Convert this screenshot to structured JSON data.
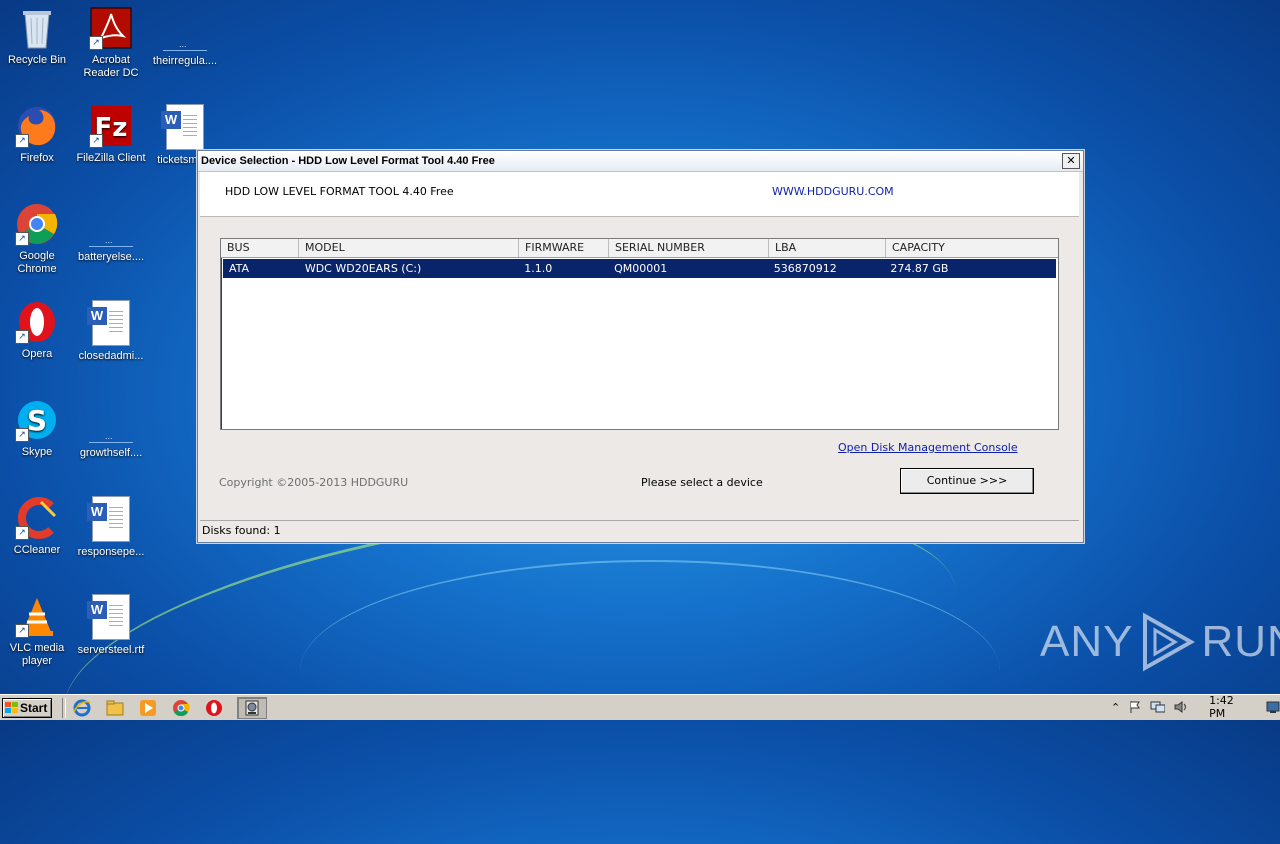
{
  "desktop": {
    "icons": [
      {
        "label": "Recycle Bin"
      },
      {
        "label": "Acrobat Reader DC"
      },
      {
        "label": "theirregula...."
      },
      {
        "label": "Firefox"
      },
      {
        "label": "FileZilla Client"
      },
      {
        "label": "ticketsma..."
      },
      {
        "label": "Google Chrome"
      },
      {
        "label": "batteryelse...."
      },
      {
        "label": "Opera"
      },
      {
        "label": "closedadmi..."
      },
      {
        "label": "Skype"
      },
      {
        "label": "growthself...."
      },
      {
        "label": "CCleaner"
      },
      {
        "label": "responsepe..."
      },
      {
        "label": "VLC media player"
      },
      {
        "label": "serversteel.rtf"
      }
    ]
  },
  "dialog": {
    "title": "Device Selection - HDD Low Level Format Tool 4.40   Free",
    "close_label": "✕",
    "app_name": "HDD LOW LEVEL FORMAT TOOL 4.40    Free",
    "app_link": "WWW.HDDGURU.COM",
    "columns": [
      "BUS",
      "MODEL",
      "FIRMWARE",
      "SERIAL NUMBER",
      "LBA",
      "CAPACITY"
    ],
    "rows": [
      {
        "bus": "ATA",
        "model": "WDC WD20EARS (C:)",
        "firmware": "1.1.0",
        "serial": "QM00001",
        "lba": "536870912",
        "capacity": "274.87 GB"
      }
    ],
    "disk_mgmt_link": "Open Disk Management Console",
    "copyright": "Copyright ©2005-2013 HDDGURU",
    "status_message": "Please select a device",
    "continue_label": "Continue >>>",
    "statusbar": "Disks found: 1"
  },
  "watermark": {
    "left": "ANY",
    "right": "RUN"
  },
  "taskbar": {
    "start_label": "Start",
    "clock": "1:42 PM"
  }
}
